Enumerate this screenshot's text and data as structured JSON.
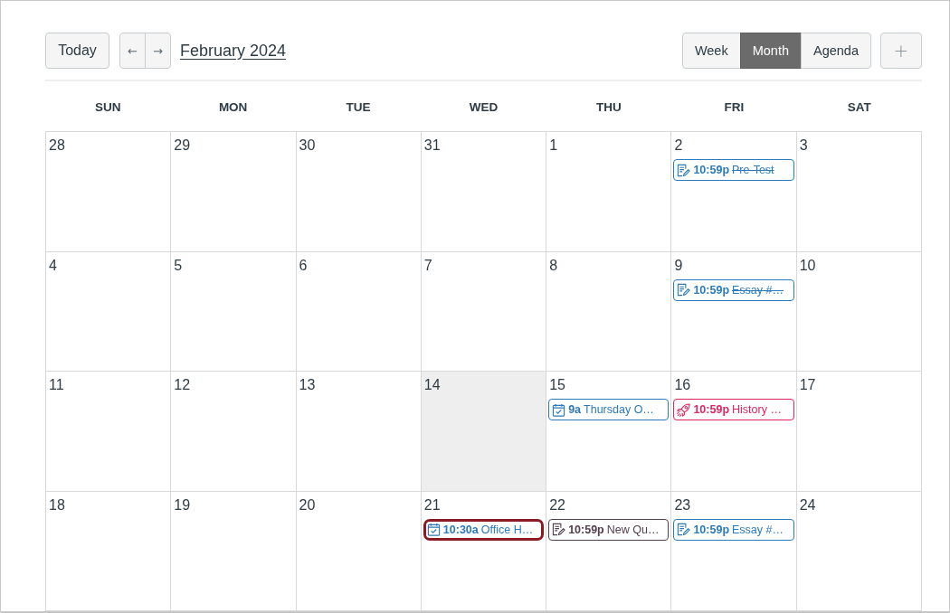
{
  "toolbar": {
    "today": "Today",
    "previous": "←",
    "next": "→",
    "title": "February 2024",
    "views": [
      {
        "label": "Week",
        "selected": false
      },
      {
        "label": "Month",
        "selected": true
      },
      {
        "label": "Agenda",
        "selected": false
      }
    ],
    "add": "+"
  },
  "weekdays": [
    "SUN",
    "MON",
    "TUE",
    "WED",
    "THU",
    "FRI",
    "SAT"
  ],
  "weeks": [
    {
      "days": [
        {
          "date": "28",
          "today": false
        },
        {
          "date": "29",
          "today": false
        },
        {
          "date": "30",
          "today": false
        },
        {
          "date": "31",
          "today": false
        },
        {
          "date": "1",
          "today": false
        },
        {
          "date": "2",
          "today": false,
          "events": [
            {
              "kind": "assignment",
              "time": "10:59p",
              "title": "Pre-Test",
              "completed": true,
              "focused": false,
              "color": "#2b7abc"
            }
          ]
        },
        {
          "date": "3",
          "today": false
        }
      ]
    },
    {
      "days": [
        {
          "date": "4",
          "today": false
        },
        {
          "date": "5",
          "today": false
        },
        {
          "date": "6",
          "today": false
        },
        {
          "date": "7",
          "today": false
        },
        {
          "date": "8",
          "today": false
        },
        {
          "date": "9",
          "today": false,
          "events": [
            {
              "kind": "assignment",
              "time": "10:59p",
              "title": "Essay #…",
              "completed": true,
              "focused": false,
              "color": "#2b7abc"
            }
          ]
        },
        {
          "date": "10",
          "today": false
        }
      ]
    },
    {
      "days": [
        {
          "date": "11",
          "today": false
        },
        {
          "date": "12",
          "today": false
        },
        {
          "date": "13",
          "today": false
        },
        {
          "date": "14",
          "today": true
        },
        {
          "date": "15",
          "today": false,
          "events": [
            {
              "kind": "event",
              "time": "9a",
              "title": "Thursday O…",
              "completed": false,
              "focused": false,
              "color": "#2b7abc"
            }
          ]
        },
        {
          "date": "16",
          "today": false,
          "events": [
            {
              "kind": "quiz",
              "time": "10:59p",
              "title": "History …",
              "completed": false,
              "focused": false,
              "color": "#e0245e"
            }
          ]
        },
        {
          "date": "17",
          "today": false
        }
      ]
    },
    {
      "days": [
        {
          "date": "18",
          "today": false
        },
        {
          "date": "19",
          "today": false
        },
        {
          "date": "20",
          "today": false
        },
        {
          "date": "21",
          "today": false,
          "events": [
            {
              "kind": "event",
              "time": "10:30a",
              "title": "Office H…",
              "completed": false,
              "focused": true,
              "color": "#2b7abc"
            }
          ]
        },
        {
          "date": "22",
          "today": false,
          "events": [
            {
              "kind": "assignment",
              "time": "10:59p",
              "title": "New Qu…",
              "completed": false,
              "focused": false,
              "color": "#53404f"
            }
          ]
        },
        {
          "date": "23",
          "today": false,
          "events": [
            {
              "kind": "assignment",
              "time": "10:59p",
              "title": "Essay #…",
              "completed": false,
              "focused": false,
              "color": "#2b7abc"
            }
          ]
        },
        {
          "date": "24",
          "today": false
        }
      ]
    }
  ]
}
